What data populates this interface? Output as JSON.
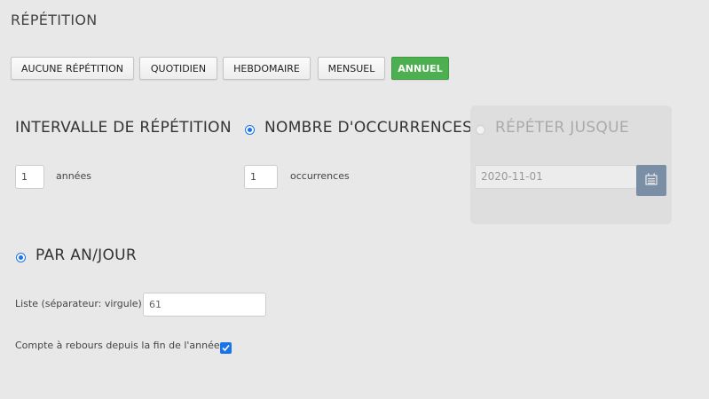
{
  "title": "RÉPÉTITION",
  "tabs": [
    {
      "label": "AUCUNE RÉPÉTITION",
      "active": false
    },
    {
      "label": "QUOTIDIEN",
      "active": false
    },
    {
      "label": "HEBDOMAIRE",
      "active": false
    },
    {
      "label": "MENSUEL",
      "active": false
    },
    {
      "label": "ANNUEL",
      "active": true
    }
  ],
  "interval": {
    "heading": "INTERVALLE DE RÉPÉTITION",
    "value": "1",
    "unit": "années"
  },
  "occurrences": {
    "heading": "NOMBRE D'OCCURRENCES",
    "selected": true,
    "value": "1",
    "unit": "occurrences"
  },
  "repeat_until": {
    "heading": "RÉPÉTER JUSQUE",
    "selected": false,
    "date": "2020-11-01",
    "icon": "calendar-icon"
  },
  "by_year_day": {
    "heading": "PAR AN/JOUR",
    "selected": true,
    "list_label": "Liste (séparateur: virgule)",
    "list_value": "61",
    "countdown_label": "Compte à rebours depuis la fin de l'année",
    "countdown_checked": true
  },
  "colors": {
    "active_tab": "#4caf50",
    "radio_accent": "#1a73e8",
    "calendar_button": "#7a8fa6"
  }
}
